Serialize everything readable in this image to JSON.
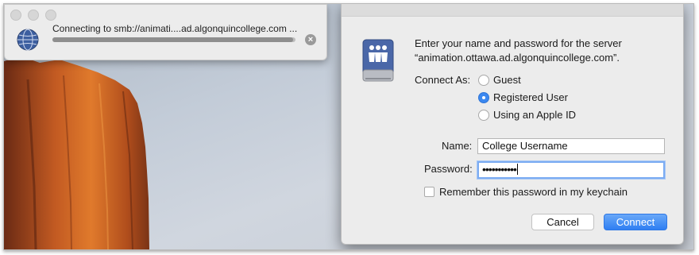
{
  "connecting_window": {
    "status": "Connecting to smb://animati....ad.algonquincollege.com ...",
    "progress": 0.99,
    "globe_icon": "network-globe-icon",
    "stop_icon": "stop-x-icon"
  },
  "auth_dialog": {
    "prompt_line1": "Enter your name and password for the server",
    "prompt_line2": "“animation.ottawa.ad.algonquincollege.com”.",
    "server_icon": "shared-server-icon",
    "connect_as_label": "Connect As:",
    "options": [
      {
        "label": "Guest",
        "selected": false
      },
      {
        "label": "Registered User",
        "selected": true
      },
      {
        "label": "Using an Apple ID",
        "selected": false
      }
    ],
    "name_label": "Name:",
    "name_value": "College Username",
    "password_label": "Password:",
    "password_value": "•••••••••••",
    "remember_label": "Remember this password in my keychain",
    "remember_checked": false,
    "cancel_label": "Cancel",
    "connect_label": "Connect",
    "accent_color": "#3b88f0"
  }
}
